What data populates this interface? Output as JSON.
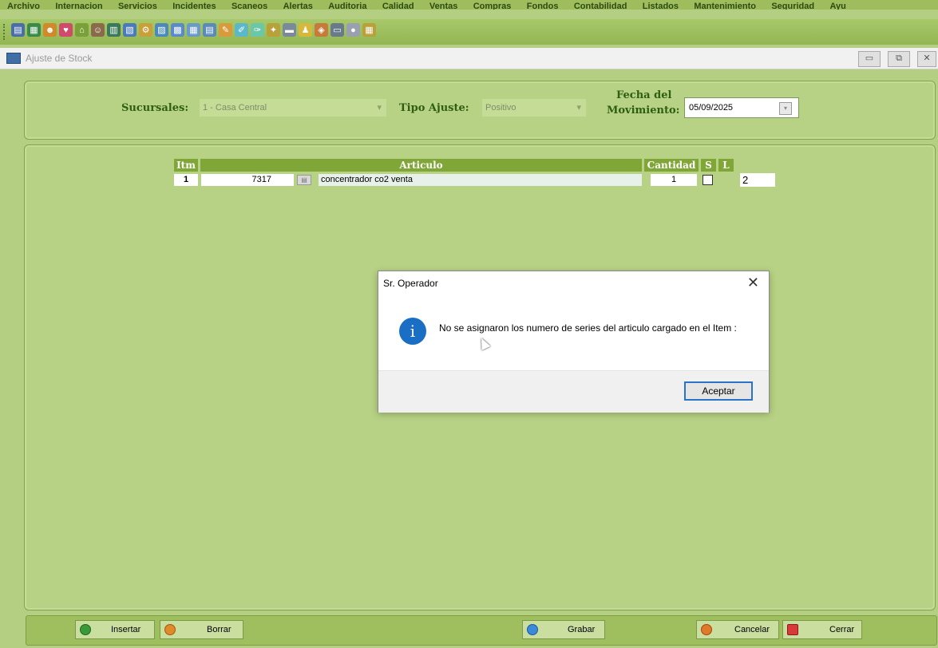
{
  "menu": [
    "Archivo",
    "Internacion",
    "Servicios",
    "Incidentes",
    "Scaneos",
    "Alertas",
    "Auditoria",
    "Calidad",
    "Ventas",
    "Compras",
    "Fondos",
    "Contabilidad",
    "Listados",
    "Mantenimiento",
    "Seguridad",
    "Ayu"
  ],
  "window": {
    "title": "Ajuste de Stock",
    "minimize": "▭",
    "restore": "⧉",
    "close": "✕"
  },
  "filters": {
    "sucursales_label": "Sucursales:",
    "sucursales_value": "1 - Casa Central",
    "tipo_label": "Tipo Ajuste:",
    "tipo_value": "Positivo",
    "fecha_label_1": "Fecha del",
    "fecha_label_2": "Movimiento:",
    "fecha_value": "05/09/2025"
  },
  "grid": {
    "headers": {
      "itm": "Itm",
      "articulo": "Articulo",
      "cantidad": "Cantidad",
      "s": "S",
      "l": "L"
    },
    "row": {
      "itm": "1",
      "codigo": "7317",
      "descripcion": "concentrador co2 venta",
      "cantidad": "1",
      "l_value": "2"
    }
  },
  "dialog": {
    "title": "Sr. Operador",
    "close": "✕",
    "icon": "i",
    "message": "No se asignaron los numero de series del articulo cargado en el Item :",
    "ok_label": "Aceptar"
  },
  "buttons": {
    "insertar": "Insertar",
    "borrar": "Borrar",
    "grabar": "Grabar",
    "cancelar": "Cancelar",
    "cerrar": "Cerrar"
  },
  "colors": {
    "accent_green": "#7fa637",
    "background": "#b4cf82",
    "info_blue": "#1a6ec4"
  }
}
